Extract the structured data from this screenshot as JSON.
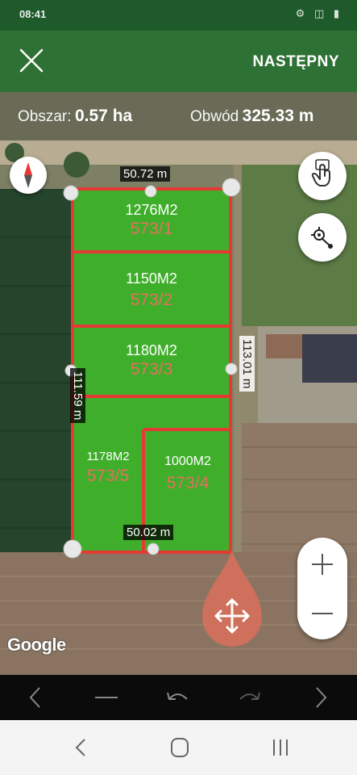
{
  "status_bar": {
    "time": "08:41",
    "icons": "⚙ ◫ ▮"
  },
  "app_bar": {
    "next_label": "NASTĘPNY"
  },
  "info": {
    "area_label": "Obszar:",
    "area_value": "0.57 ha",
    "perimeter_label": "Obwód",
    "perimeter_value": "325.33 m"
  },
  "dimensions": {
    "top": "50.72 m",
    "bottom": "50.02 m",
    "left": "111.59 m",
    "right": "113.01 m"
  },
  "plots": [
    {
      "area": "1276M2",
      "number": "573/1"
    },
    {
      "area": "1150M2",
      "number": "573/2"
    },
    {
      "area": "1180M2",
      "number": "573/3"
    },
    {
      "area": "1178M2",
      "number": "573/5"
    },
    {
      "area": "1000M2",
      "number": "573/4"
    }
  ],
  "google_label": "Google",
  "colors": {
    "app_bar": "#2e7134",
    "plot_fill": "#3fae2a",
    "plot_border": "#e53935",
    "plot_number": "#e57060",
    "move_marker": "#d9705a"
  }
}
